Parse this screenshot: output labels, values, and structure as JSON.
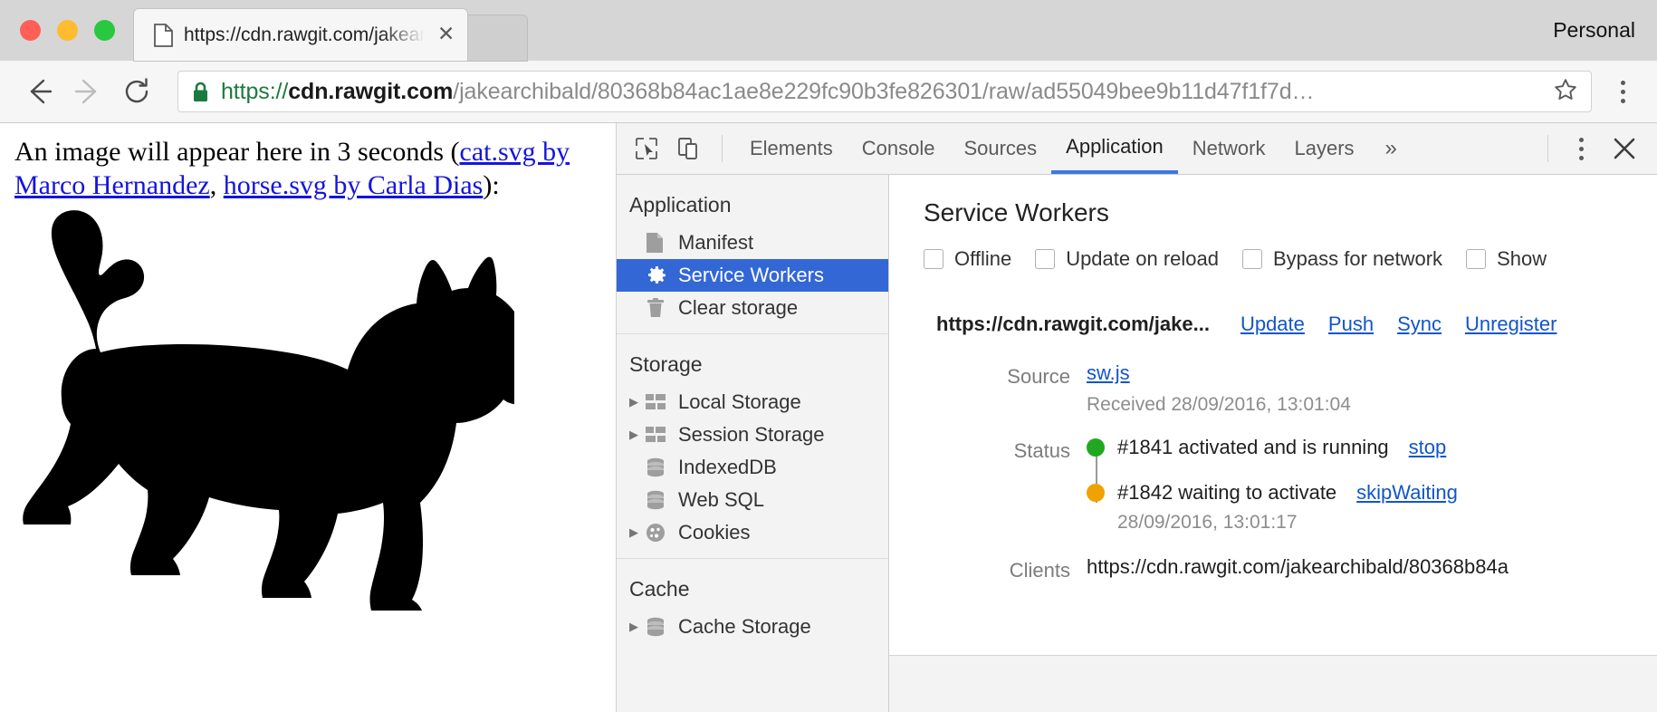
{
  "browser": {
    "profile_label": "Personal",
    "tab": {
      "title": "https://cdn.rawgit.com/jakearc",
      "favicon_icon": "page-icon",
      "close_icon": "close-icon"
    },
    "nav": {
      "back_icon": "back-arrow-icon",
      "forward_icon": "forward-arrow-icon",
      "reload_icon": "reload-icon",
      "menu_icon": "kebab-menu-icon"
    },
    "omnibox": {
      "lock_icon": "lock-icon",
      "star_icon": "star-icon",
      "scheme": "https://",
      "host": "cdn.rawgit.com",
      "path": "/jakearchibald/80368b84ac1ae8e229fc90b3fe826301/raw/ad55049bee9b11d47f1f7d…"
    }
  },
  "page": {
    "text_before": "An image will appear here in 3 seconds (",
    "link1": "cat.svg by Marco Hernandez",
    "separator": ", ",
    "link2": "horse.svg by Carla Dias",
    "text_after": "):",
    "image_alt": "cat-silhouette"
  },
  "devtools": {
    "toolbar": {
      "inspect_icon": "inspect-cursor-icon",
      "device_icon": "device-toolbar-icon",
      "more_tabs_icon": "chevron-double-right-icon",
      "settings_icon": "kebab-menu-icon",
      "close_icon": "close-icon"
    },
    "tabs": [
      {
        "label": "Elements",
        "active": false
      },
      {
        "label": "Console",
        "active": false
      },
      {
        "label": "Sources",
        "active": false
      },
      {
        "label": "Application",
        "active": true
      },
      {
        "label": "Network",
        "active": false
      },
      {
        "label": "Layers",
        "active": false
      }
    ],
    "more_tabs_glyph": "»",
    "sidebar": [
      {
        "title": "Application",
        "items": [
          {
            "label": "Manifest",
            "icon": "document-icon",
            "arrow": false,
            "selected": false
          },
          {
            "label": "Service Workers",
            "icon": "gear-icon",
            "arrow": false,
            "selected": true
          },
          {
            "label": "Clear storage",
            "icon": "trash-icon",
            "arrow": false,
            "selected": false
          }
        ]
      },
      {
        "title": "Storage",
        "items": [
          {
            "label": "Local Storage",
            "icon": "table-icon",
            "arrow": true,
            "selected": false
          },
          {
            "label": "Session Storage",
            "icon": "table-icon",
            "arrow": true,
            "selected": false
          },
          {
            "label": "IndexedDB",
            "icon": "database-icon",
            "arrow": false,
            "selected": false
          },
          {
            "label": "Web SQL",
            "icon": "database-icon",
            "arrow": false,
            "selected": false
          },
          {
            "label": "Cookies",
            "icon": "cookie-icon",
            "arrow": true,
            "selected": false
          }
        ]
      },
      {
        "title": "Cache",
        "items": [
          {
            "label": "Cache Storage",
            "icon": "database-icon",
            "arrow": true,
            "selected": false
          }
        ]
      }
    ],
    "service_workers": {
      "panel_title": "Service Workers",
      "options": [
        {
          "label": "Offline",
          "checked": false
        },
        {
          "label": "Update on reload",
          "checked": false
        },
        {
          "label": "Bypass for network",
          "checked": false
        },
        {
          "label": "Show",
          "checked": false
        }
      ],
      "scope": "https://cdn.rawgit.com/jake...",
      "actions": [
        "Update",
        "Push",
        "Sync",
        "Unregister"
      ],
      "source_label": "Source",
      "source_link": "sw.js",
      "source_received": "Received 28/09/2016, 13:01:04",
      "status_label": "Status",
      "versions": [
        {
          "dot_color": "#21a821",
          "text": "#1841 activated and is running",
          "action": "stop",
          "timestamp": ""
        },
        {
          "dot_color": "#f0a202",
          "text": "#1842 waiting to activate",
          "action": "skipWaiting",
          "timestamp": "28/09/2016, 13:01:17"
        }
      ],
      "clients_label": "Clients",
      "clients_value": "https://cdn.rawgit.com/jakearchibald/80368b84a"
    }
  },
  "colors": {
    "accent": "#3367d6",
    "tab_underline": "#3b78e7",
    "link": "#1155cc",
    "page_link": "#1414e0",
    "status_running": "#21a821",
    "status_waiting": "#f0a202",
    "lock_green": "#1d7a3f"
  }
}
